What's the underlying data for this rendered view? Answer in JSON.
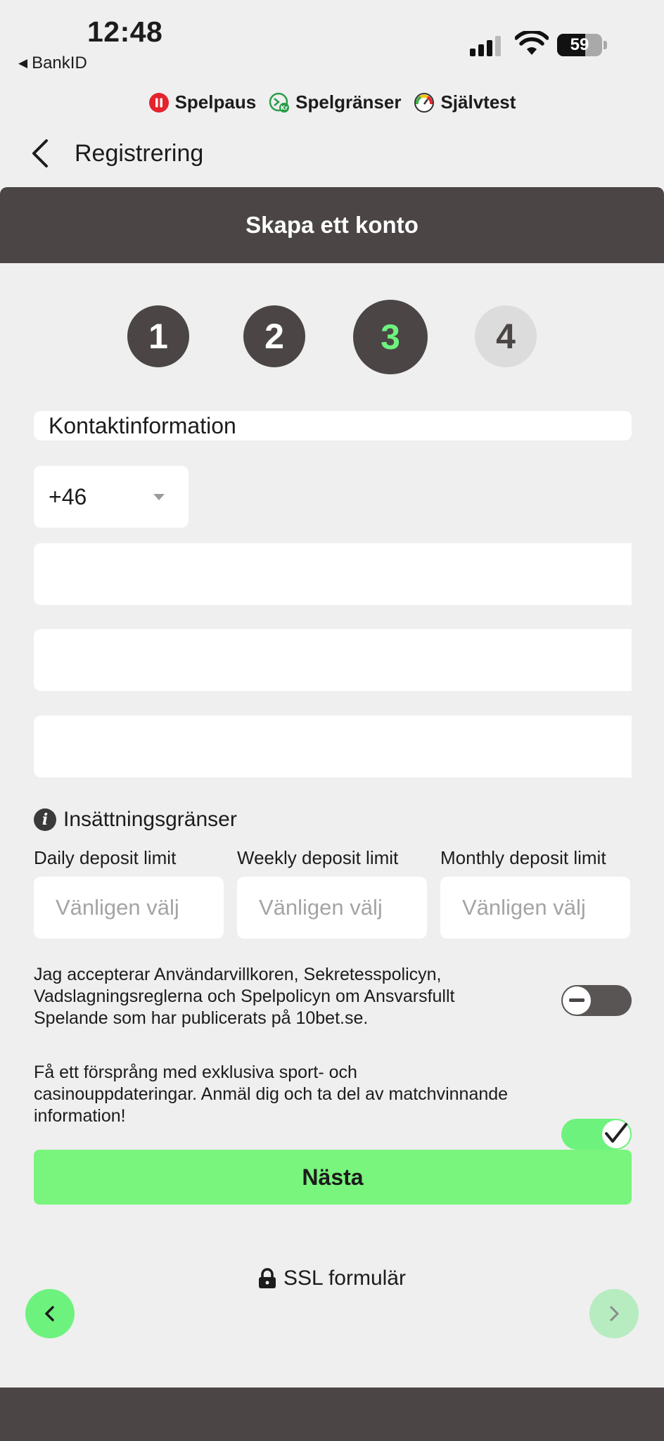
{
  "status_bar": {
    "time": "12:48",
    "back_app": "BankID",
    "battery": "59",
    "signal_icon": "cellular-signal-icon",
    "wifi_icon": "wifi-icon"
  },
  "rg_bar": {
    "items": [
      {
        "label": "Spelpaus",
        "icon": "pause-icon"
      },
      {
        "label": "Spelgränser",
        "icon": "limits-icon"
      },
      {
        "label": "Självtest",
        "icon": "gauge-icon"
      }
    ]
  },
  "nav": {
    "title": "Registrering"
  },
  "header": {
    "title": "Skapa ett konto"
  },
  "steps": [
    {
      "label": "1",
      "state": "done"
    },
    {
      "label": "2",
      "state": "done"
    },
    {
      "label": "3",
      "state": "active"
    },
    {
      "label": "4",
      "state": "todo"
    }
  ],
  "form": {
    "section_title": "Kontaktinformation",
    "country_code": "+46",
    "fields": [
      "",
      "",
      ""
    ],
    "limits": {
      "title": "Insättningsgränser",
      "daily_label": "Daily deposit limit",
      "weekly_label": "Weekly deposit limit",
      "monthly_label": "Monthly deposit limit",
      "placeholder": "Vänligen välj"
    },
    "terms_text": "Jag accepterar Användarvillkoren, Sekretesspolicyn, Vadslagningsreglerna och Spelpolicyn om Ansvarsfullt Spelande som har publicerats på 10bet.se.",
    "terms_toggle": false,
    "marketing_text": "Få ett försprång med exklusiva sport- och casinouppdateringar. Anmäl dig och ta del av matchvinnande information!",
    "marketing_toggle": true,
    "next_label": "Nästa"
  },
  "footer": {
    "ssl_label": "SSL formulär"
  },
  "colors": {
    "dark": "#4b4545",
    "accent_green": "#6ef27e",
    "button_green": "#79f57d"
  }
}
